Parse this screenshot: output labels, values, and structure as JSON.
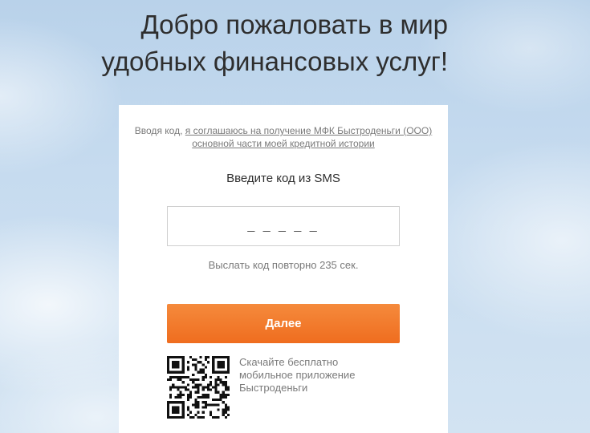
{
  "header": {
    "title_line1": "Добро пожаловать в мир",
    "title_line2": "удобных финансовых услуг!"
  },
  "form": {
    "consent_prefix": "Вводя код, ",
    "consent_link": "я соглашаюсь на получение МФК Быстроденьги (ООО) основной части моей кредитной истории",
    "enter_code_label": "Введите код из SMS",
    "code_input": {
      "value": "",
      "placeholder": "_ _ _ _ _"
    },
    "resend_text": "Выслать код повторно 235 сек.",
    "next_button_label": "Далее"
  },
  "app_promo": {
    "line1": "Скачайте бесплатно",
    "line2": "мобильное приложение",
    "line3": "Быстроденьги",
    "qr_icon": "qr-code-icon"
  },
  "colors": {
    "accent": "#f07a2a",
    "text": "#2e2e2e",
    "muted": "#7a7a7a"
  }
}
